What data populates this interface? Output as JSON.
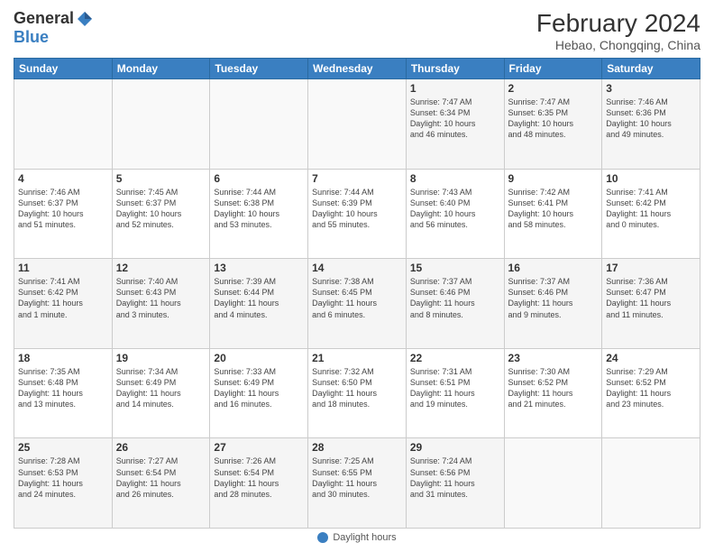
{
  "header": {
    "logo_general": "General",
    "logo_blue": "Blue",
    "month_title": "February 2024",
    "location": "Hebao, Chongqing, China"
  },
  "weekdays": [
    "Sunday",
    "Monday",
    "Tuesday",
    "Wednesday",
    "Thursday",
    "Friday",
    "Saturday"
  ],
  "footer": {
    "label": "Daylight hours"
  },
  "weeks": [
    [
      {
        "day": "",
        "info": ""
      },
      {
        "day": "",
        "info": ""
      },
      {
        "day": "",
        "info": ""
      },
      {
        "day": "",
        "info": ""
      },
      {
        "day": "1",
        "info": "Sunrise: 7:47 AM\nSunset: 6:34 PM\nDaylight: 10 hours\nand 46 minutes."
      },
      {
        "day": "2",
        "info": "Sunrise: 7:47 AM\nSunset: 6:35 PM\nDaylight: 10 hours\nand 48 minutes."
      },
      {
        "day": "3",
        "info": "Sunrise: 7:46 AM\nSunset: 6:36 PM\nDaylight: 10 hours\nand 49 minutes."
      }
    ],
    [
      {
        "day": "4",
        "info": "Sunrise: 7:46 AM\nSunset: 6:37 PM\nDaylight: 10 hours\nand 51 minutes."
      },
      {
        "day": "5",
        "info": "Sunrise: 7:45 AM\nSunset: 6:37 PM\nDaylight: 10 hours\nand 52 minutes."
      },
      {
        "day": "6",
        "info": "Sunrise: 7:44 AM\nSunset: 6:38 PM\nDaylight: 10 hours\nand 53 minutes."
      },
      {
        "day": "7",
        "info": "Sunrise: 7:44 AM\nSunset: 6:39 PM\nDaylight: 10 hours\nand 55 minutes."
      },
      {
        "day": "8",
        "info": "Sunrise: 7:43 AM\nSunset: 6:40 PM\nDaylight: 10 hours\nand 56 minutes."
      },
      {
        "day": "9",
        "info": "Sunrise: 7:42 AM\nSunset: 6:41 PM\nDaylight: 10 hours\nand 58 minutes."
      },
      {
        "day": "10",
        "info": "Sunrise: 7:41 AM\nSunset: 6:42 PM\nDaylight: 11 hours\nand 0 minutes."
      }
    ],
    [
      {
        "day": "11",
        "info": "Sunrise: 7:41 AM\nSunset: 6:42 PM\nDaylight: 11 hours\nand 1 minute."
      },
      {
        "day": "12",
        "info": "Sunrise: 7:40 AM\nSunset: 6:43 PM\nDaylight: 11 hours\nand 3 minutes."
      },
      {
        "day": "13",
        "info": "Sunrise: 7:39 AM\nSunset: 6:44 PM\nDaylight: 11 hours\nand 4 minutes."
      },
      {
        "day": "14",
        "info": "Sunrise: 7:38 AM\nSunset: 6:45 PM\nDaylight: 11 hours\nand 6 minutes."
      },
      {
        "day": "15",
        "info": "Sunrise: 7:37 AM\nSunset: 6:46 PM\nDaylight: 11 hours\nand 8 minutes."
      },
      {
        "day": "16",
        "info": "Sunrise: 7:37 AM\nSunset: 6:46 PM\nDaylight: 11 hours\nand 9 minutes."
      },
      {
        "day": "17",
        "info": "Sunrise: 7:36 AM\nSunset: 6:47 PM\nDaylight: 11 hours\nand 11 minutes."
      }
    ],
    [
      {
        "day": "18",
        "info": "Sunrise: 7:35 AM\nSunset: 6:48 PM\nDaylight: 11 hours\nand 13 minutes."
      },
      {
        "day": "19",
        "info": "Sunrise: 7:34 AM\nSunset: 6:49 PM\nDaylight: 11 hours\nand 14 minutes."
      },
      {
        "day": "20",
        "info": "Sunrise: 7:33 AM\nSunset: 6:49 PM\nDaylight: 11 hours\nand 16 minutes."
      },
      {
        "day": "21",
        "info": "Sunrise: 7:32 AM\nSunset: 6:50 PM\nDaylight: 11 hours\nand 18 minutes."
      },
      {
        "day": "22",
        "info": "Sunrise: 7:31 AM\nSunset: 6:51 PM\nDaylight: 11 hours\nand 19 minutes."
      },
      {
        "day": "23",
        "info": "Sunrise: 7:30 AM\nSunset: 6:52 PM\nDaylight: 11 hours\nand 21 minutes."
      },
      {
        "day": "24",
        "info": "Sunrise: 7:29 AM\nSunset: 6:52 PM\nDaylight: 11 hours\nand 23 minutes."
      }
    ],
    [
      {
        "day": "25",
        "info": "Sunrise: 7:28 AM\nSunset: 6:53 PM\nDaylight: 11 hours\nand 24 minutes."
      },
      {
        "day": "26",
        "info": "Sunrise: 7:27 AM\nSunset: 6:54 PM\nDaylight: 11 hours\nand 26 minutes."
      },
      {
        "day": "27",
        "info": "Sunrise: 7:26 AM\nSunset: 6:54 PM\nDaylight: 11 hours\nand 28 minutes."
      },
      {
        "day": "28",
        "info": "Sunrise: 7:25 AM\nSunset: 6:55 PM\nDaylight: 11 hours\nand 30 minutes."
      },
      {
        "day": "29",
        "info": "Sunrise: 7:24 AM\nSunset: 6:56 PM\nDaylight: 11 hours\nand 31 minutes."
      },
      {
        "day": "",
        "info": ""
      },
      {
        "day": "",
        "info": ""
      }
    ]
  ]
}
